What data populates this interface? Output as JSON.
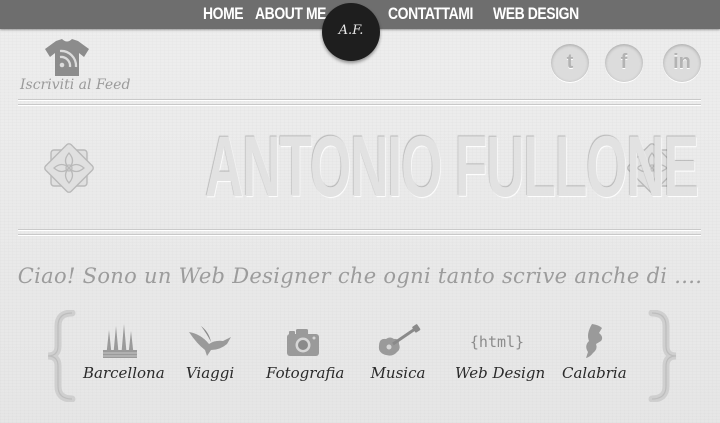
{
  "nav": {
    "home": "HOME",
    "about": "ABOUT ME",
    "contact": "CONTATTAMI",
    "webdesign": "WEB DESIGN"
  },
  "logo": {
    "text": "A.F."
  },
  "feed": {
    "caption": "Iscriviti al Feed",
    "icon": "rss-tshirt-icon"
  },
  "social": [
    {
      "name": "twitter",
      "glyph": "t"
    },
    {
      "name": "facebook",
      "glyph": "f"
    },
    {
      "name": "linkedin",
      "glyph": "in"
    }
  ],
  "hero": {
    "title": "ANTONIO FULLONE"
  },
  "tagline": "Ciao! Sono un Web Designer che ogni tanto scrive anche di ....",
  "categories": [
    {
      "label": "Barcellona",
      "icon": "sagrada-familia-icon"
    },
    {
      "label": "Viaggi",
      "icon": "bird-icon"
    },
    {
      "label": "Fotografia",
      "icon": "camera-icon"
    },
    {
      "label": "Musica",
      "icon": "guitar-icon"
    },
    {
      "label": "Web Design",
      "icon": "html-tag-icon",
      "icon_text": "{html}"
    },
    {
      "label": "Calabria",
      "icon": "calabria-map-icon"
    }
  ],
  "colors": {
    "topbar": "#6e6e6e",
    "logo": "#1e1e1e",
    "background": "#ececec"
  }
}
